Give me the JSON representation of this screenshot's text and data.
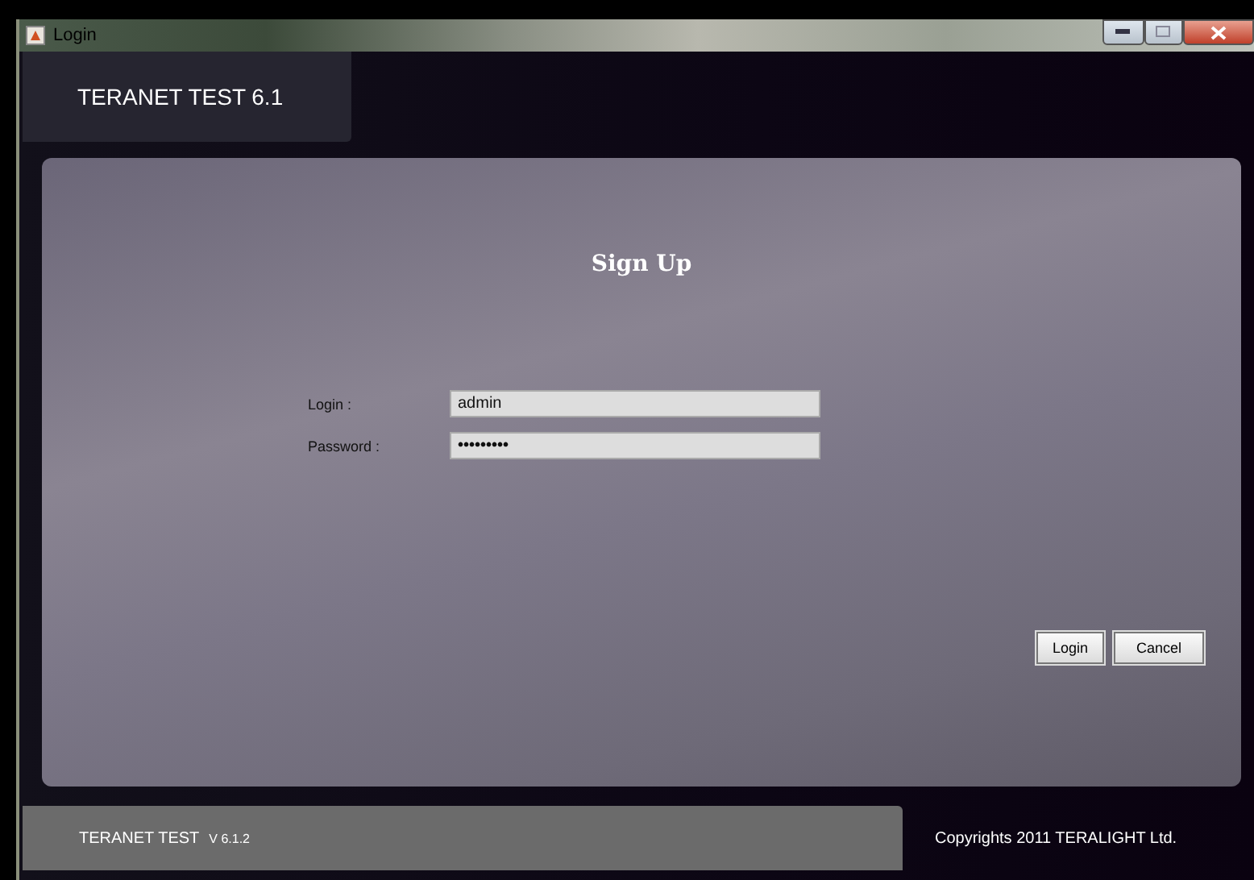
{
  "window": {
    "title": "Login"
  },
  "header": {
    "title": "TERANET TEST  6.1"
  },
  "form": {
    "heading": "Sign Up",
    "fields": [
      {
        "label": "Login :",
        "value": "admin"
      },
      {
        "label": "Password :",
        "value": "•••••••••"
      }
    ],
    "buttons": [
      "Login",
      "Cancel"
    ]
  },
  "footer": {
    "product": "TERANET TEST",
    "version": "V 6.1.2",
    "copyright": "Copyrights 2011  TERALIGHT Ltd."
  }
}
